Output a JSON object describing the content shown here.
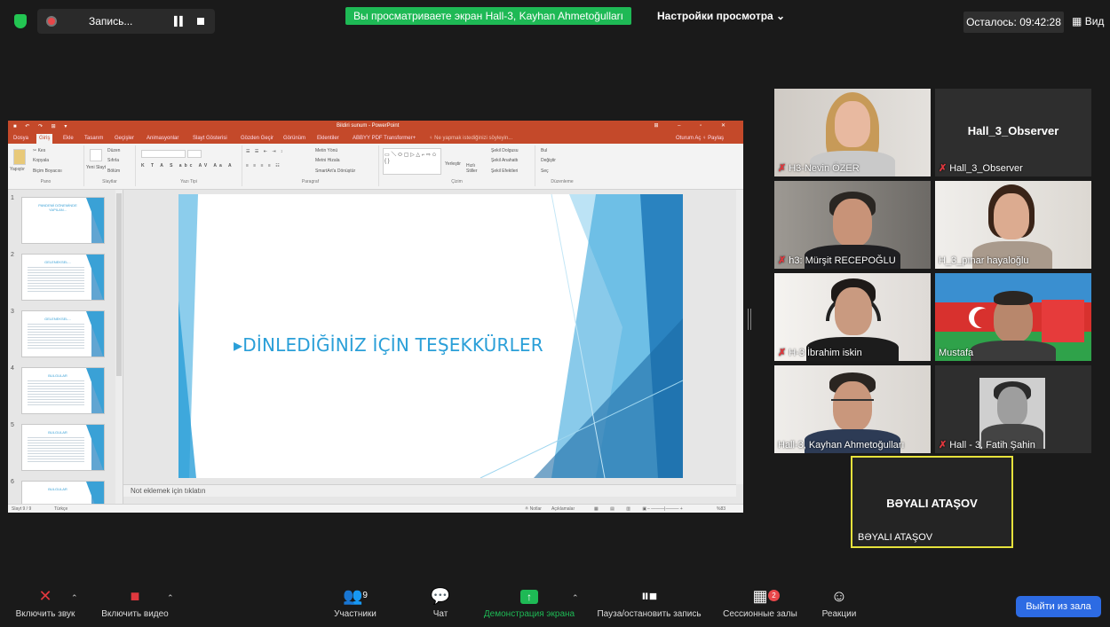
{
  "topbar": {
    "recording_label": "Запись...",
    "share_banner": "Вы просматриваете экран Hall-3, Kayhan Ahmetoğulları",
    "view_options": "Настройки просмотра ⌄",
    "time_left": "Осталось: 09:42:28",
    "view_label": "Вид"
  },
  "powerpoint": {
    "window_title": "Bildiri sunum - PowerPoint",
    "tabs": [
      "Dosya",
      "Giriş",
      "Ekle",
      "Tasarım",
      "Geçişler",
      "Animasyonlar",
      "Slayt Gösterisi",
      "Gözden Geçir",
      "Görünüm",
      "Eklentiler",
      "ABBYY PDF Transformer+"
    ],
    "tell_me": "♀ Ne yapmak istediğinizi söyleyin...",
    "share_label": "Oturum Aç  ♀ Paylaş",
    "ribbon": {
      "paste": "Yapıştır",
      "cut": "✂ Kes",
      "copy": "Kopyala",
      "format_painter": "Biçim Boyacısı",
      "clipboard": "Pano",
      "new_slide": "Yeni Slayt",
      "layout": "Düzen",
      "reset": "Sıfırla",
      "section": "Bölüm",
      "slides": "Slaytlar",
      "font": "Yazı Tipi",
      "text_direction": "Metin Yönü",
      "align_text": "Metni Hizala",
      "smartart": "SmartArt'a Dönüştür",
      "paragraph": "Paragraf",
      "arrange": "Yerleştir",
      "quick_styles": "Hızlı Stiller",
      "shape_fill": "Şekil Dolgusu",
      "shape_outline": "Şekil Anahattı",
      "shape_effects": "Şekil Efektleri",
      "drawing": "Çizim",
      "find": "Bul",
      "replace": "Değiştir",
      "select": "Seç",
      "editing": "Düzenleme"
    },
    "thumbnails": [
      {
        "num": "1",
        "title": "PANDEMİ DÖNEMİNDE YAPILAN..."
      },
      {
        "num": "2",
        "title": "GELENEKSEL..."
      },
      {
        "num": "3",
        "title": "GELENEKSEL..."
      },
      {
        "num": "4",
        "title": "BULGULAR"
      },
      {
        "num": "5",
        "title": "BULGULAR"
      },
      {
        "num": "6",
        "title": "BULGULAR"
      }
    ],
    "slide_title": "▸DİNLEDİĞİNİZ İÇİN TEŞEKKÜRLER",
    "notes_placeholder": "Not eklemek için tıklatın",
    "status_slide": "Slayt 9 / 9",
    "status_lang": "Türkçe",
    "status_notes": "≗ Notlar",
    "status_comments": "Açıklamalar",
    "status_zoom": "%83"
  },
  "participants": [
    {
      "name": "H3-Nevin ÖZER",
      "muted": true
    },
    {
      "name": "Hall_3_Observer",
      "muted": true,
      "big_name": "Hall_3_Observer"
    },
    {
      "name": "h3: Mürşit RECEPOĞLU",
      "muted": true
    },
    {
      "name": "H_3_pınar hayaloğlu",
      "muted": false
    },
    {
      "name": "H-3 İbrahim iskin",
      "muted": true
    },
    {
      "name": "Mustafa",
      "muted": false
    },
    {
      "name": "Hall-3, Kayhan Ahmetoğulları",
      "muted": false
    },
    {
      "name": "Hall - 3, Fatih Şahin",
      "muted": true
    }
  ],
  "active_speaker": {
    "big_name": "BƏYALI ATAŞOV",
    "name": "BƏYALI ATAŞOV"
  },
  "toolbar": {
    "audio": "Включить звук",
    "video": "Включить видео",
    "participants": "Участники",
    "participants_count": "9",
    "chat": "Чат",
    "share": "Демонстрация экрана",
    "record": "Пауза/остановить запись",
    "breakout": "Сессионные залы",
    "breakout_badge": "2",
    "reactions": "Реакции",
    "leave": "Выйти из зала"
  },
  "colors": {
    "share_green": "#1eb955",
    "ppt_accent": "#c4492a",
    "slide_blue": "#2a9fd8",
    "leave_blue": "#2d6be3",
    "active_border": "#e6e23c"
  }
}
